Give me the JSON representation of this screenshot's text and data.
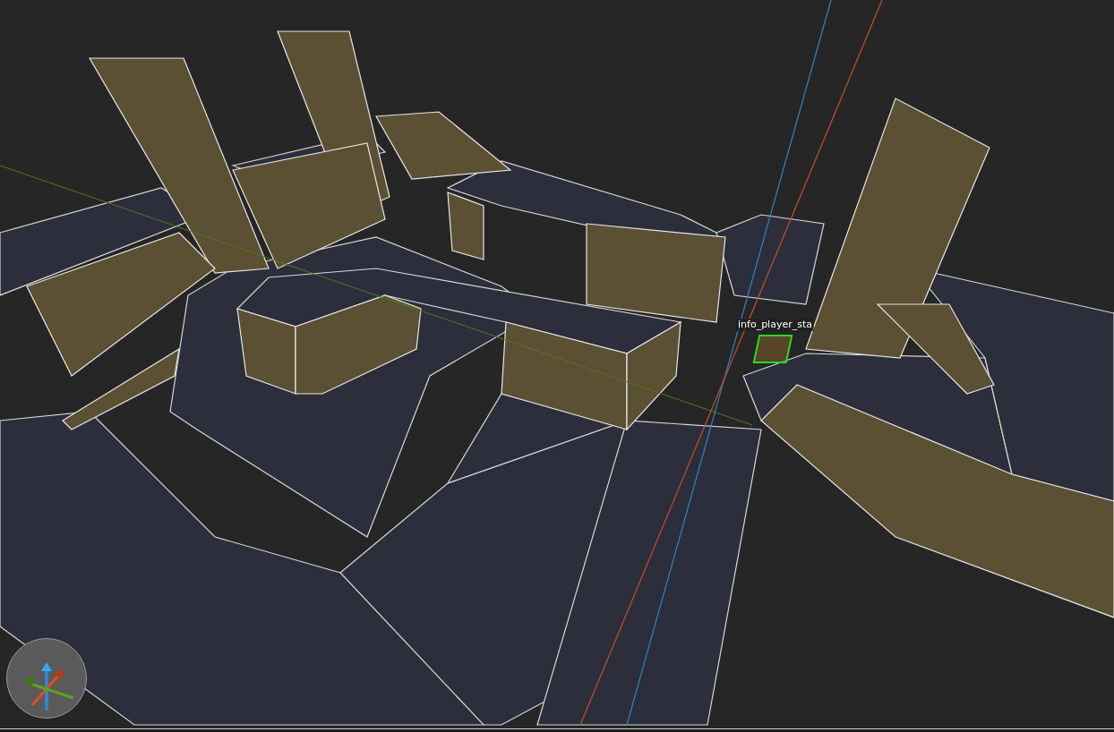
{
  "viewport": {
    "entity_label": {
      "text": "info_player_sta",
      "selected": true
    }
  }
}
